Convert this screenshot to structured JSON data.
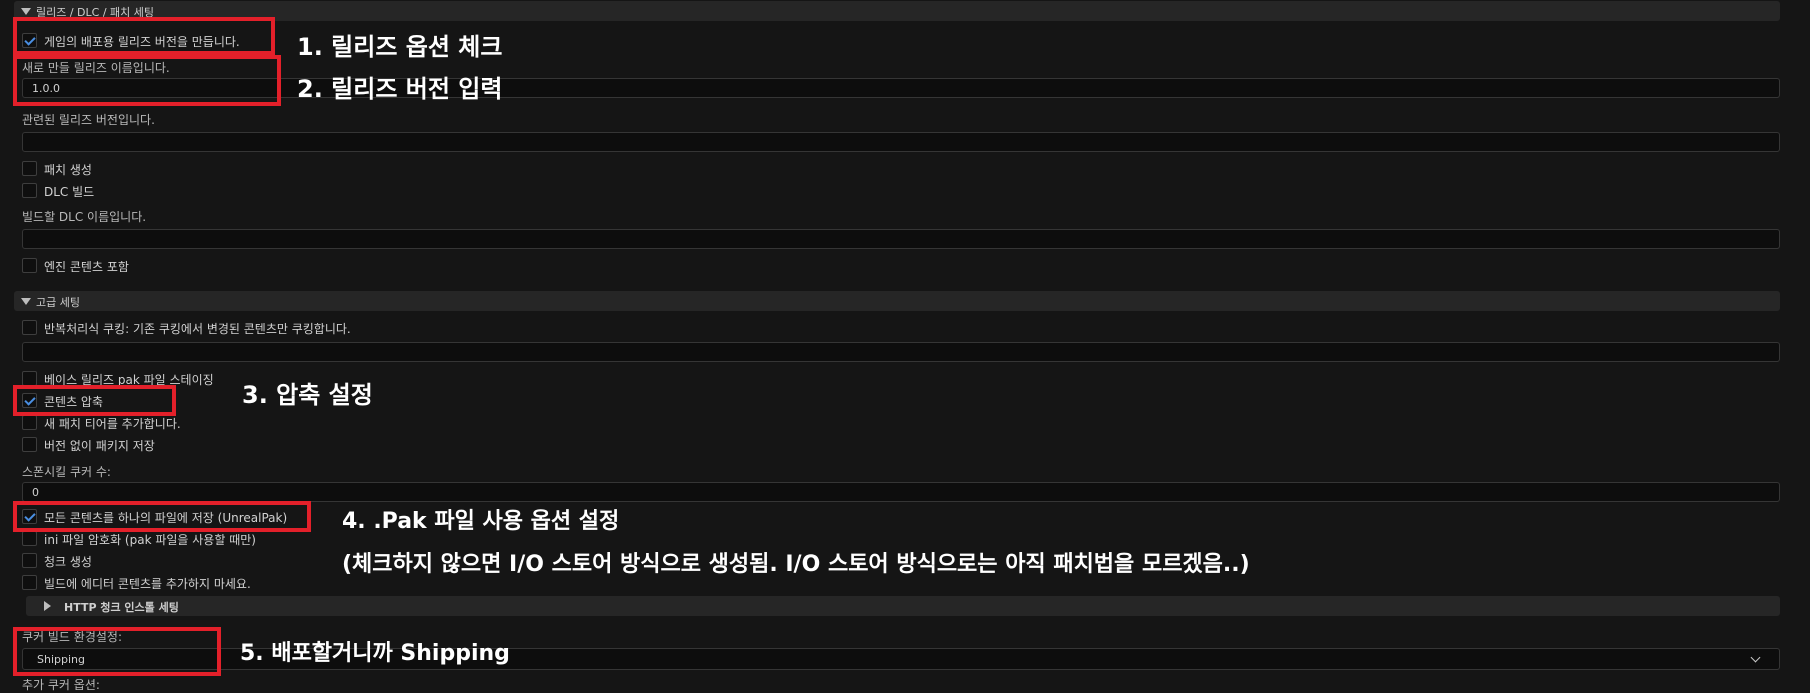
{
  "sections": {
    "release": {
      "title": "릴리즈 / DLC / 패치 세팅"
    },
    "advanced": {
      "title": "고급 세팅"
    },
    "http_chunk": {
      "title": "HTTP 청크 인스톨 세팅"
    }
  },
  "release": {
    "create_release": {
      "label": "게임의 배포용 릴리즈 버전을 만듭니다.",
      "checked": true
    },
    "new_release_label": "새로 만들 릴리즈 이름입니다.",
    "new_release_value": "1.0.0",
    "based_on_label": "관련된 릴리즈 버전입니다.",
    "based_on_value": "",
    "generate_patch": {
      "label": "패치 생성",
      "checked": false
    },
    "build_dlc": {
      "label": "DLC 빌드",
      "checked": false
    },
    "dlc_name_label": "빌드할 DLC 이름입니다.",
    "dlc_name_value": "",
    "include_engine": {
      "label": "엔진 콘텐츠 포함",
      "checked": false
    }
  },
  "advanced": {
    "iterative": {
      "label": "반복처리식 쿠킹: 기존 쿠킹에서 변경된 콘텐츠만 쿠킹합니다.",
      "checked": false
    },
    "iterative_value": "",
    "stage_base_pak": {
      "label": "베이스 릴리즈 pak 파일 스테이징",
      "checked": false
    },
    "compress": {
      "label": "콘텐츠 압축",
      "checked": true
    },
    "add_patch_tier": {
      "label": "새 패치 티어를 추가합니다.",
      "checked": false
    },
    "save_unversioned": {
      "label": "버전 없이 패키지 저장",
      "checked": false
    },
    "num_cookers_label": "스폰시킬 쿠커 수:",
    "num_cookers_value": "0",
    "use_pak": {
      "label": "모든 콘텐츠를 하나의 파일에 저장 (UnrealPak)",
      "checked": true
    },
    "encrypt_ini": {
      "label": "ini 파일 암호화 (pak 파일을 사용할 때만)",
      "checked": false
    },
    "gen_chunks": {
      "label": "청크 생성",
      "checked": false
    },
    "no_editor_content": {
      "label": "빌드에 에디터 콘텐츠를 추가하지 마세요.",
      "checked": false
    },
    "cooker_build_config_label": "쿠커 빌드 환경설정:",
    "cooker_build_config_value": "Shipping",
    "additional_options_label": "추가 쿠커 옵션:"
  },
  "annotations": {
    "a1": "1. 릴리즈 옵션 체크",
    "a2": "2. 릴리즈 버전 입력",
    "a3": "3. 압축 설정",
    "a4_line1": "4. .Pak 파일 사용 옵션 설정",
    "a4_line2": "(체크하지 않으면 I/O 스토어 방식으로 생성됨. I/O 스토어 방식으로는 아직 패치법을 모르겠음..)",
    "a5": "5. 배포할거니까 Shipping"
  },
  "colors": {
    "highlight": "#e3202a",
    "check": "#4a8fe2",
    "background": "#151515"
  }
}
